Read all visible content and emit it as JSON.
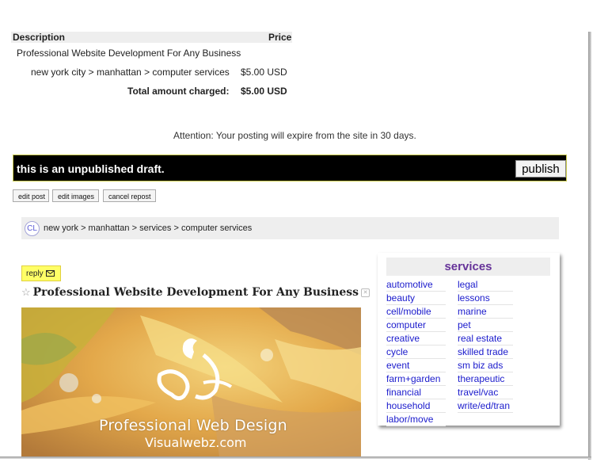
{
  "invoice": {
    "header_description": "Description",
    "header_price": "Price",
    "item_description": "Professional Website Development For Any Business",
    "location": "new york city > manhattan > computer services",
    "amount": "$5.00 USD",
    "total_label": "Total amount charged:",
    "total_value": "$5.00 USD"
  },
  "attention": "Attention: Your posting will expire from the site in 30 days.",
  "draft": {
    "message": "this is an unpublished draft.",
    "publish_label": "publish"
  },
  "buttons": {
    "edit_post": "edit post",
    "edit_images": "edit images",
    "cancel_repost": "cancel repost"
  },
  "breadcrumb": {
    "logo": "CL",
    "path": "new york > manhattan > services > computer services"
  },
  "reply": {
    "label": "reply"
  },
  "post": {
    "star": "☆",
    "title": "Professional Website Development For Any Business",
    "hide_icon": "✕"
  },
  "banner": {
    "line1": "Professional Web Design",
    "line2": "Visualwebz.com"
  },
  "services": {
    "title": "services",
    "left": [
      "automotive",
      "beauty",
      "cell/mobile",
      "computer",
      "creative",
      "cycle",
      "event",
      "farm+garden",
      "financial",
      "household",
      "labor/move"
    ],
    "right": [
      "legal",
      "lessons",
      "marine",
      "pet",
      "real estate",
      "skilled trade",
      "sm biz ads",
      "therapeutic",
      "travel/vac",
      "write/ed/tran"
    ]
  },
  "colors": {
    "draft_bar": "#000000",
    "reply_bg": "#ffff66",
    "services_title": "#663399",
    "link": "#1a1acc"
  }
}
